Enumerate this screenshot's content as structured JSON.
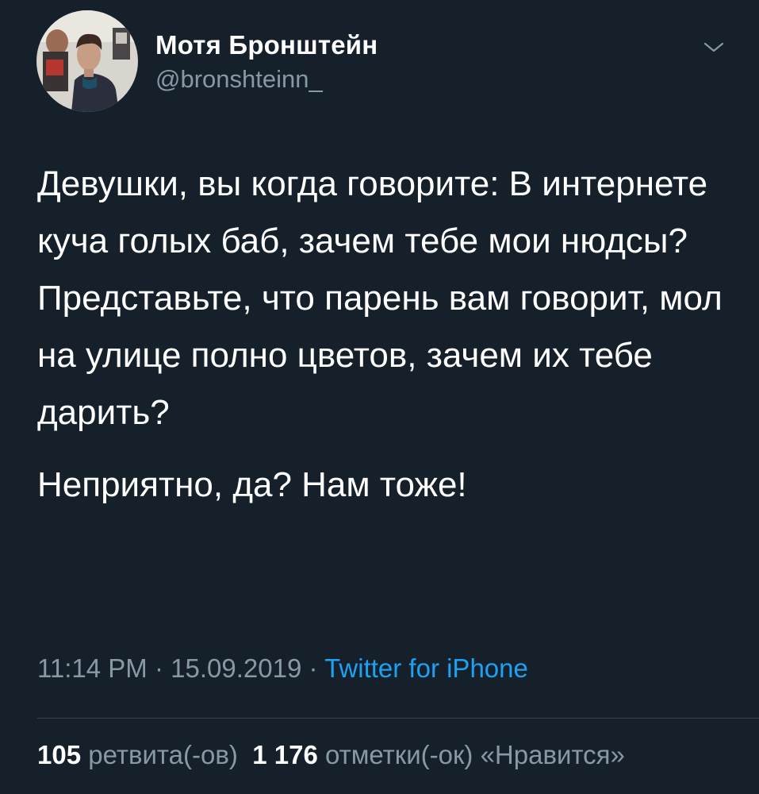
{
  "author": {
    "display_name": "Мотя Бронштейн",
    "handle": "@bronshteinn_"
  },
  "tweet": {
    "lines": [
      "Девушки, вы когда говорите: В интернете куча голых баб, зачем тебе мои нюдсы?",
      "Представьте, что парень вам говорит, мол на улице полно цветов, зачем их тебе дарить?",
      "Неприятно, да? Нам тоже!"
    ]
  },
  "meta": {
    "time": "11:14 PM",
    "separator": "·",
    "date": "15.09.2019",
    "source": "Twitter for iPhone"
  },
  "stats": {
    "retweets_count": "105",
    "retweets_label": "ретвита(-ов)",
    "likes_count": "1 176",
    "likes_label": "отметки(-ок) «Нравится»"
  },
  "icons": {
    "menu": "chevron-down-icon"
  },
  "colors": {
    "background": "#15202b",
    "text_primary": "#ffffff",
    "text_secondary": "#8899a6",
    "link": "#1da1f2",
    "divider": "#38444d"
  }
}
